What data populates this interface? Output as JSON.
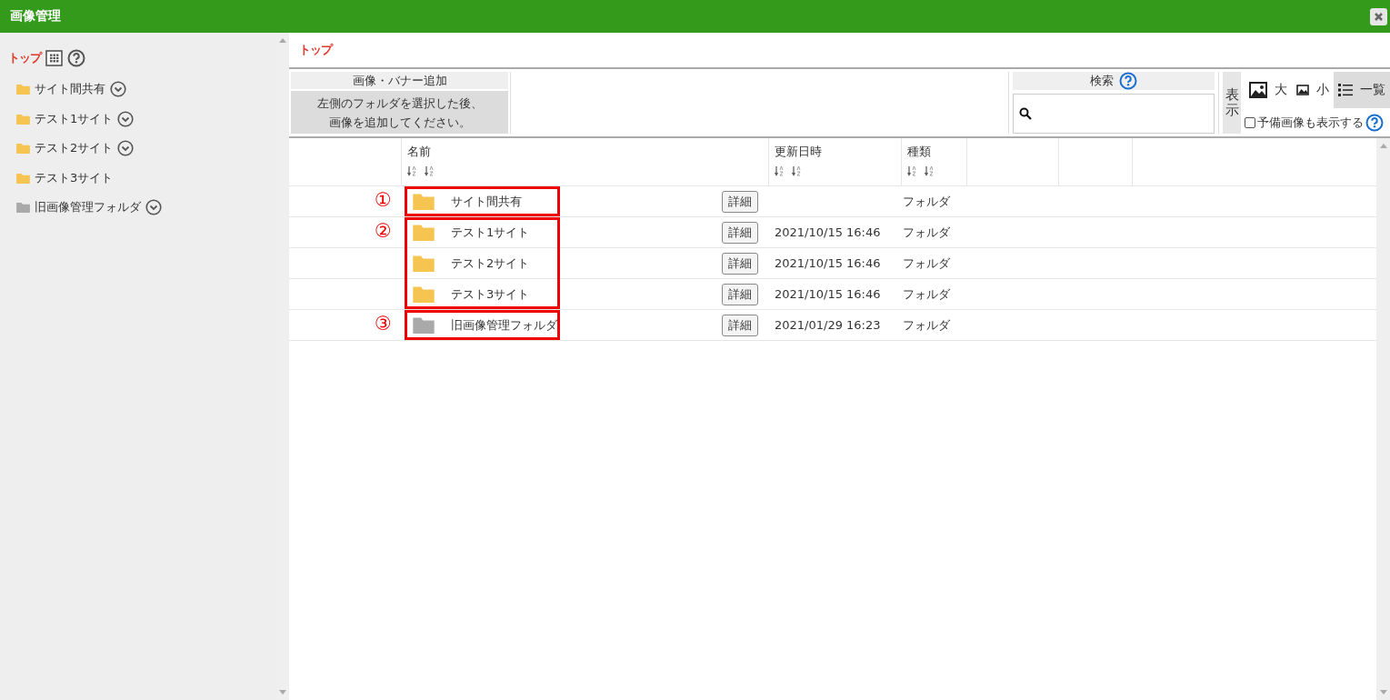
{
  "window": {
    "title": "画像管理"
  },
  "sidebar": {
    "root": "トップ",
    "items": [
      {
        "label": "サイト間共有",
        "color": "#f5c451",
        "expandable": true
      },
      {
        "label": "テスト1サイト",
        "color": "#f5c451",
        "expandable": true
      },
      {
        "label": "テスト2サイト",
        "color": "#f5c451",
        "expandable": true
      },
      {
        "label": "テスト3サイト",
        "color": "#f5c451",
        "expandable": false
      },
      {
        "label": "旧画像管理フォルダ",
        "color": "#a9a9a9",
        "expandable": true
      }
    ]
  },
  "breadcrumb": "トップ",
  "toolbar": {
    "add_title": "画像・バナー追加",
    "add_note": [
      "左側のフォルダを選択した後、",
      "画像を追加してください。"
    ],
    "search_label": "検索",
    "view_label": "表示",
    "view_options": [
      {
        "kind": "large",
        "label": "大",
        "selected": false
      },
      {
        "kind": "small",
        "label": "小",
        "selected": false
      },
      {
        "kind": "list",
        "label": "一覧",
        "selected": true
      }
    ],
    "spare_label": "予備画像も表示する",
    "spare_checked": false
  },
  "table": {
    "columns": [
      {
        "label": "名前"
      },
      {
        "label": "更新日時"
      },
      {
        "label": "種類"
      }
    ],
    "groups": [
      {
        "callout": "①",
        "rows": [
          {
            "name": "サイト間共有",
            "color": "#f5c451",
            "detail": "詳細",
            "type": "フォルダ"
          }
        ]
      },
      {
        "callout": "②",
        "rows": [
          {
            "name": "テスト1サイト",
            "color": "#f5c451",
            "detail": "詳細",
            "updated": "2021/10/15 16:46",
            "type": "フォルダ"
          },
          {
            "name": "テスト2サイト",
            "color": "#f5c451",
            "detail": "詳細",
            "updated": "2021/10/15 16:46",
            "type": "フォルダ"
          },
          {
            "name": "テスト3サイト",
            "color": "#f5c451",
            "detail": "詳細",
            "updated": "2021/10/15 16:46",
            "type": "フォルダ"
          }
        ]
      },
      {
        "callout": "③",
        "rows": [
          {
            "name": "旧画像管理フォルダ",
            "color": "#a9a9a9",
            "detail": "詳細",
            "updated": "2021/01/29 16:23",
            "type": "フォルダ"
          }
        ]
      }
    ]
  }
}
